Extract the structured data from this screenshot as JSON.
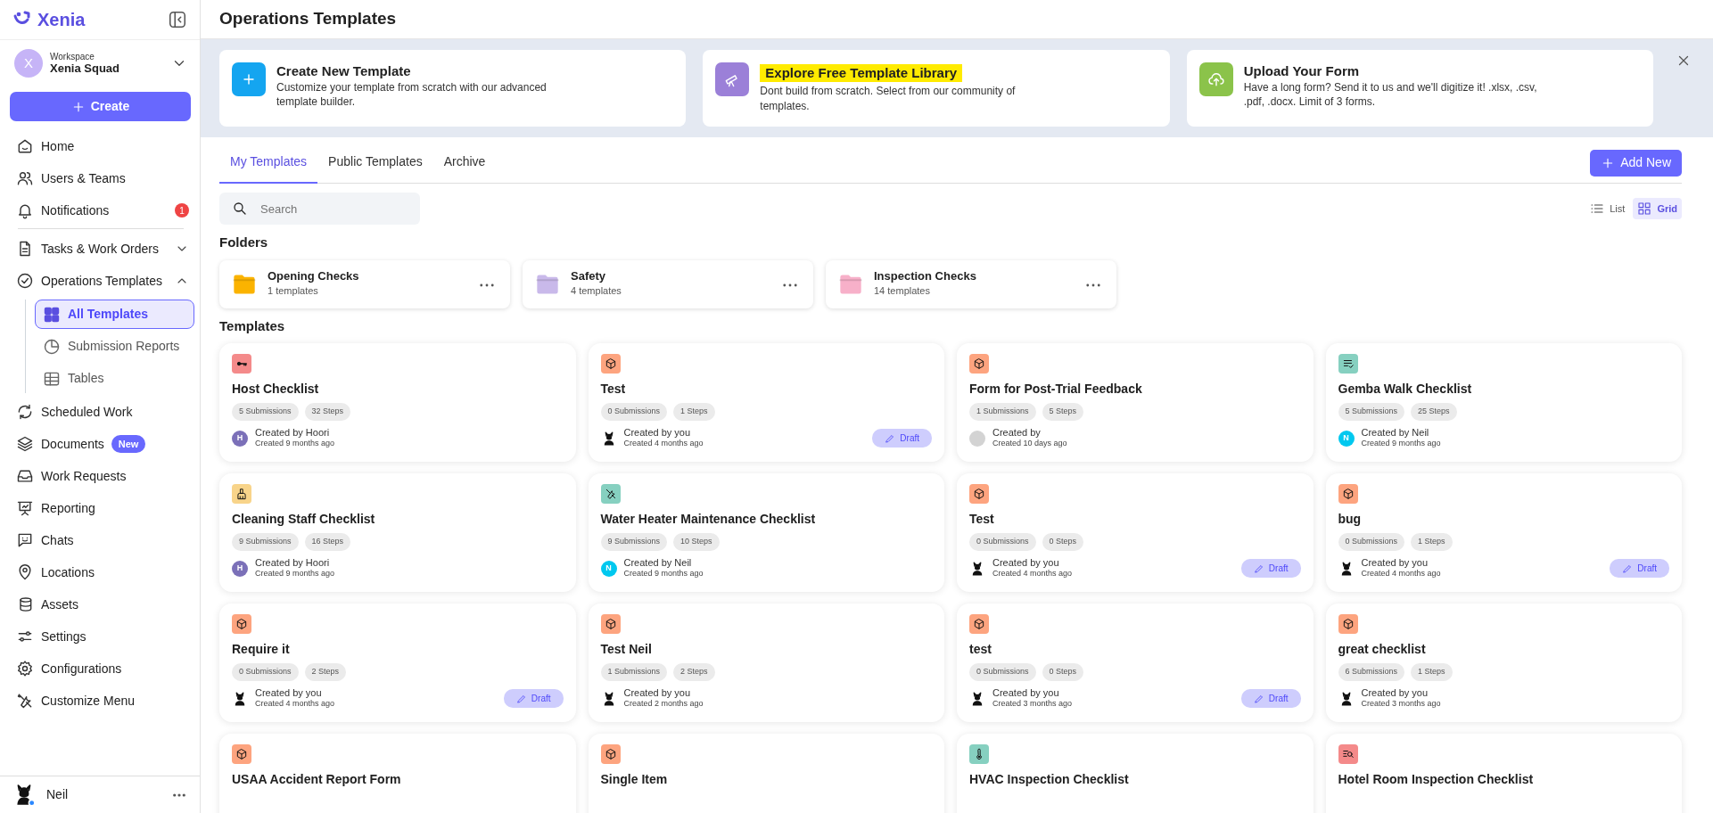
{
  "app": {
    "logo": "Xenia"
  },
  "workspace": {
    "label": "Workspace",
    "name": "Xenia Squad",
    "avatar": "X"
  },
  "create_button": "Create",
  "nav_sections": [
    {
      "items": [
        {
          "label": "Home",
          "selected": false
        },
        {
          "label": "Users & Teams",
          "selected": false
        },
        {
          "label": "Notifications",
          "selected": false,
          "badge": {
            "kind": "count",
            "text": "1"
          }
        }
      ]
    },
    {
      "items": [
        {
          "label": "Tasks & Work Orders",
          "selected": false,
          "expanded": false
        },
        {
          "label": "Operations Templates",
          "selected": false,
          "expanded": true,
          "children": [
            {
              "label": "All Templates",
              "selected": true
            },
            {
              "label": "Submission Reports",
              "selected": false
            },
            {
              "label": "Tables",
              "selected": false
            }
          ]
        },
        {
          "label": "Scheduled Work",
          "selected": false
        },
        {
          "label": "Documents",
          "selected": false,
          "badge": {
            "kind": "new",
            "text": "New"
          }
        },
        {
          "label": "Work Requests",
          "selected": false
        },
        {
          "label": "Reporting",
          "selected": false
        },
        {
          "label": "Chats",
          "selected": false
        },
        {
          "label": "Locations",
          "selected": false
        },
        {
          "label": "Assets",
          "selected": false
        },
        {
          "label": "Settings",
          "selected": false
        },
        {
          "label": "Configurations",
          "selected": false
        },
        {
          "label": "Customize Menu",
          "selected": false
        }
      ]
    }
  ],
  "user": {
    "name": "Neil"
  },
  "page_title": "Operations Templates",
  "banner": [
    {
      "title": "Create New Template",
      "description": "Customize your template from scratch with our advanced template builder.",
      "color": "#14a5f0",
      "highlighted": false
    },
    {
      "title": "Explore Free Template Library",
      "description": "Dont build from scratch. Select from our community of templates.",
      "color": "#9b80d8",
      "highlighted": true
    },
    {
      "title": "Upload Your Form",
      "description": "Have a long form? Send it to us and we'll digitize it! .xlsx, .csv, .pdf, .docx. Limit of 3 forms.",
      "color": "#8bc34a",
      "highlighted": false
    }
  ],
  "tabs": [
    {
      "label": "My Templates",
      "selected": true
    },
    {
      "label": "Public Templates",
      "selected": false
    },
    {
      "label": "Archive",
      "selected": false
    }
  ],
  "add_button": "Add New",
  "search": {
    "placeholder": "Search"
  },
  "view_toggle": [
    {
      "label": "List",
      "selected": false
    },
    {
      "label": "Grid",
      "selected": true
    }
  ],
  "folders_heading": "Folders",
  "folders": [
    {
      "name": "Opening Checks",
      "count": "1 templates",
      "color": "#fbb300"
    },
    {
      "name": "Safety",
      "count": "4 templates",
      "color": "#c9b9ea"
    },
    {
      "name": "Inspection Checks",
      "count": "14 templates",
      "color": "#f7b0c9"
    }
  ],
  "templates_heading": "Templates",
  "templates": [
    {
      "kind": "key",
      "color": "#f48a8a",
      "title": "Host Checklist",
      "submissions": "5 Submissions",
      "steps": "32 Steps",
      "created_by": "Created by Hoori",
      "created_ago": "Created 9 months ago",
      "avatar": {
        "kind": "letter",
        "letter": "H",
        "color": "#7b70b8"
      }
    },
    {
      "kind": "box",
      "color": "#fda47f",
      "title": "Test",
      "submissions": "0 Submissions",
      "steps": "1 Steps",
      "created_by": "Created by you",
      "created_ago": "Created 4 months ago",
      "avatar": {
        "kind": "silhouette"
      },
      "status": "Draft"
    },
    {
      "kind": "box",
      "color": "#fda47f",
      "title": "Form for Post-Trial Feedback",
      "submissions": "1 Submissions",
      "steps": "5 Steps",
      "created_by": "Created by",
      "created_ago": "Created 10 days ago",
      "avatar": {
        "kind": "blank"
      }
    },
    {
      "kind": "checklist",
      "color": "#86d0c0",
      "title": "Gemba Walk Checklist",
      "submissions": "5 Submissions",
      "steps": "25 Steps",
      "created_by": "Created by Neil",
      "created_ago": "Created 9 months ago",
      "avatar": {
        "kind": "letter",
        "letter": "N",
        "color": "#00c8ef"
      }
    },
    {
      "kind": "brush",
      "color": "#f8d48a",
      "title": "Cleaning Staff Checklist",
      "submissions": "9 Submissions",
      "steps": "16 Steps",
      "created_by": "Created by Hoori",
      "created_ago": "Created 9 months ago",
      "avatar": {
        "kind": "letter",
        "letter": "H",
        "color": "#7b70b8"
      }
    },
    {
      "kind": "tools",
      "color": "#86d0c0",
      "title": "Water Heater Maintenance Checklist",
      "submissions": "9 Submissions",
      "steps": "10 Steps",
      "created_by": "Created by Neil",
      "created_ago": "Created 9 months ago",
      "avatar": {
        "kind": "letter",
        "letter": "N",
        "color": "#00c8ef"
      }
    },
    {
      "kind": "box",
      "color": "#fda47f",
      "title": "Test",
      "submissions": "0 Submissions",
      "steps": "0 Steps",
      "created_by": "Created by you",
      "created_ago": "Created 4 months ago",
      "avatar": {
        "kind": "silhouette"
      },
      "status": "Draft"
    },
    {
      "kind": "box",
      "color": "#fda47f",
      "title": "bug",
      "submissions": "0 Submissions",
      "steps": "1 Steps",
      "created_by": "Created by you",
      "created_ago": "Created 4 months ago",
      "avatar": {
        "kind": "silhouette"
      },
      "status": "Draft"
    },
    {
      "kind": "box",
      "color": "#fda47f",
      "title": "Require it",
      "submissions": "0 Submissions",
      "steps": "2 Steps",
      "created_by": "Created by you",
      "created_ago": "Created 4 months ago",
      "avatar": {
        "kind": "silhouette"
      },
      "status": "Draft"
    },
    {
      "kind": "box",
      "color": "#fda47f",
      "title": "Test Neil",
      "submissions": "1 Submissions",
      "steps": "2 Steps",
      "created_by": "Created by you",
      "created_ago": "Created 2 months ago",
      "avatar": {
        "kind": "silhouette"
      }
    },
    {
      "kind": "box",
      "color": "#fda47f",
      "title": "test",
      "submissions": "0 Submissions",
      "steps": "0 Steps",
      "created_by": "Created by you",
      "created_ago": "Created 3 months ago",
      "avatar": {
        "kind": "silhouette"
      },
      "status": "Draft"
    },
    {
      "kind": "box",
      "color": "#fda47f",
      "title": "great checklist",
      "submissions": "6 Submissions",
      "steps": "1 Steps",
      "created_by": "Created by you",
      "created_ago": "Created 3 months ago",
      "avatar": {
        "kind": "silhouette"
      }
    },
    {
      "kind": "box",
      "color": "#fda47f",
      "title": "USAA Accident Report Form"
    },
    {
      "kind": "box",
      "color": "#fda47f",
      "title": "Single Item"
    },
    {
      "kind": "thermometer",
      "color": "#86d0c0",
      "title": "HVAC Inspection Checklist"
    },
    {
      "kind": "inspection",
      "color": "#f48a8a",
      "title": "Hotel Room Inspection Checklist"
    }
  ]
}
